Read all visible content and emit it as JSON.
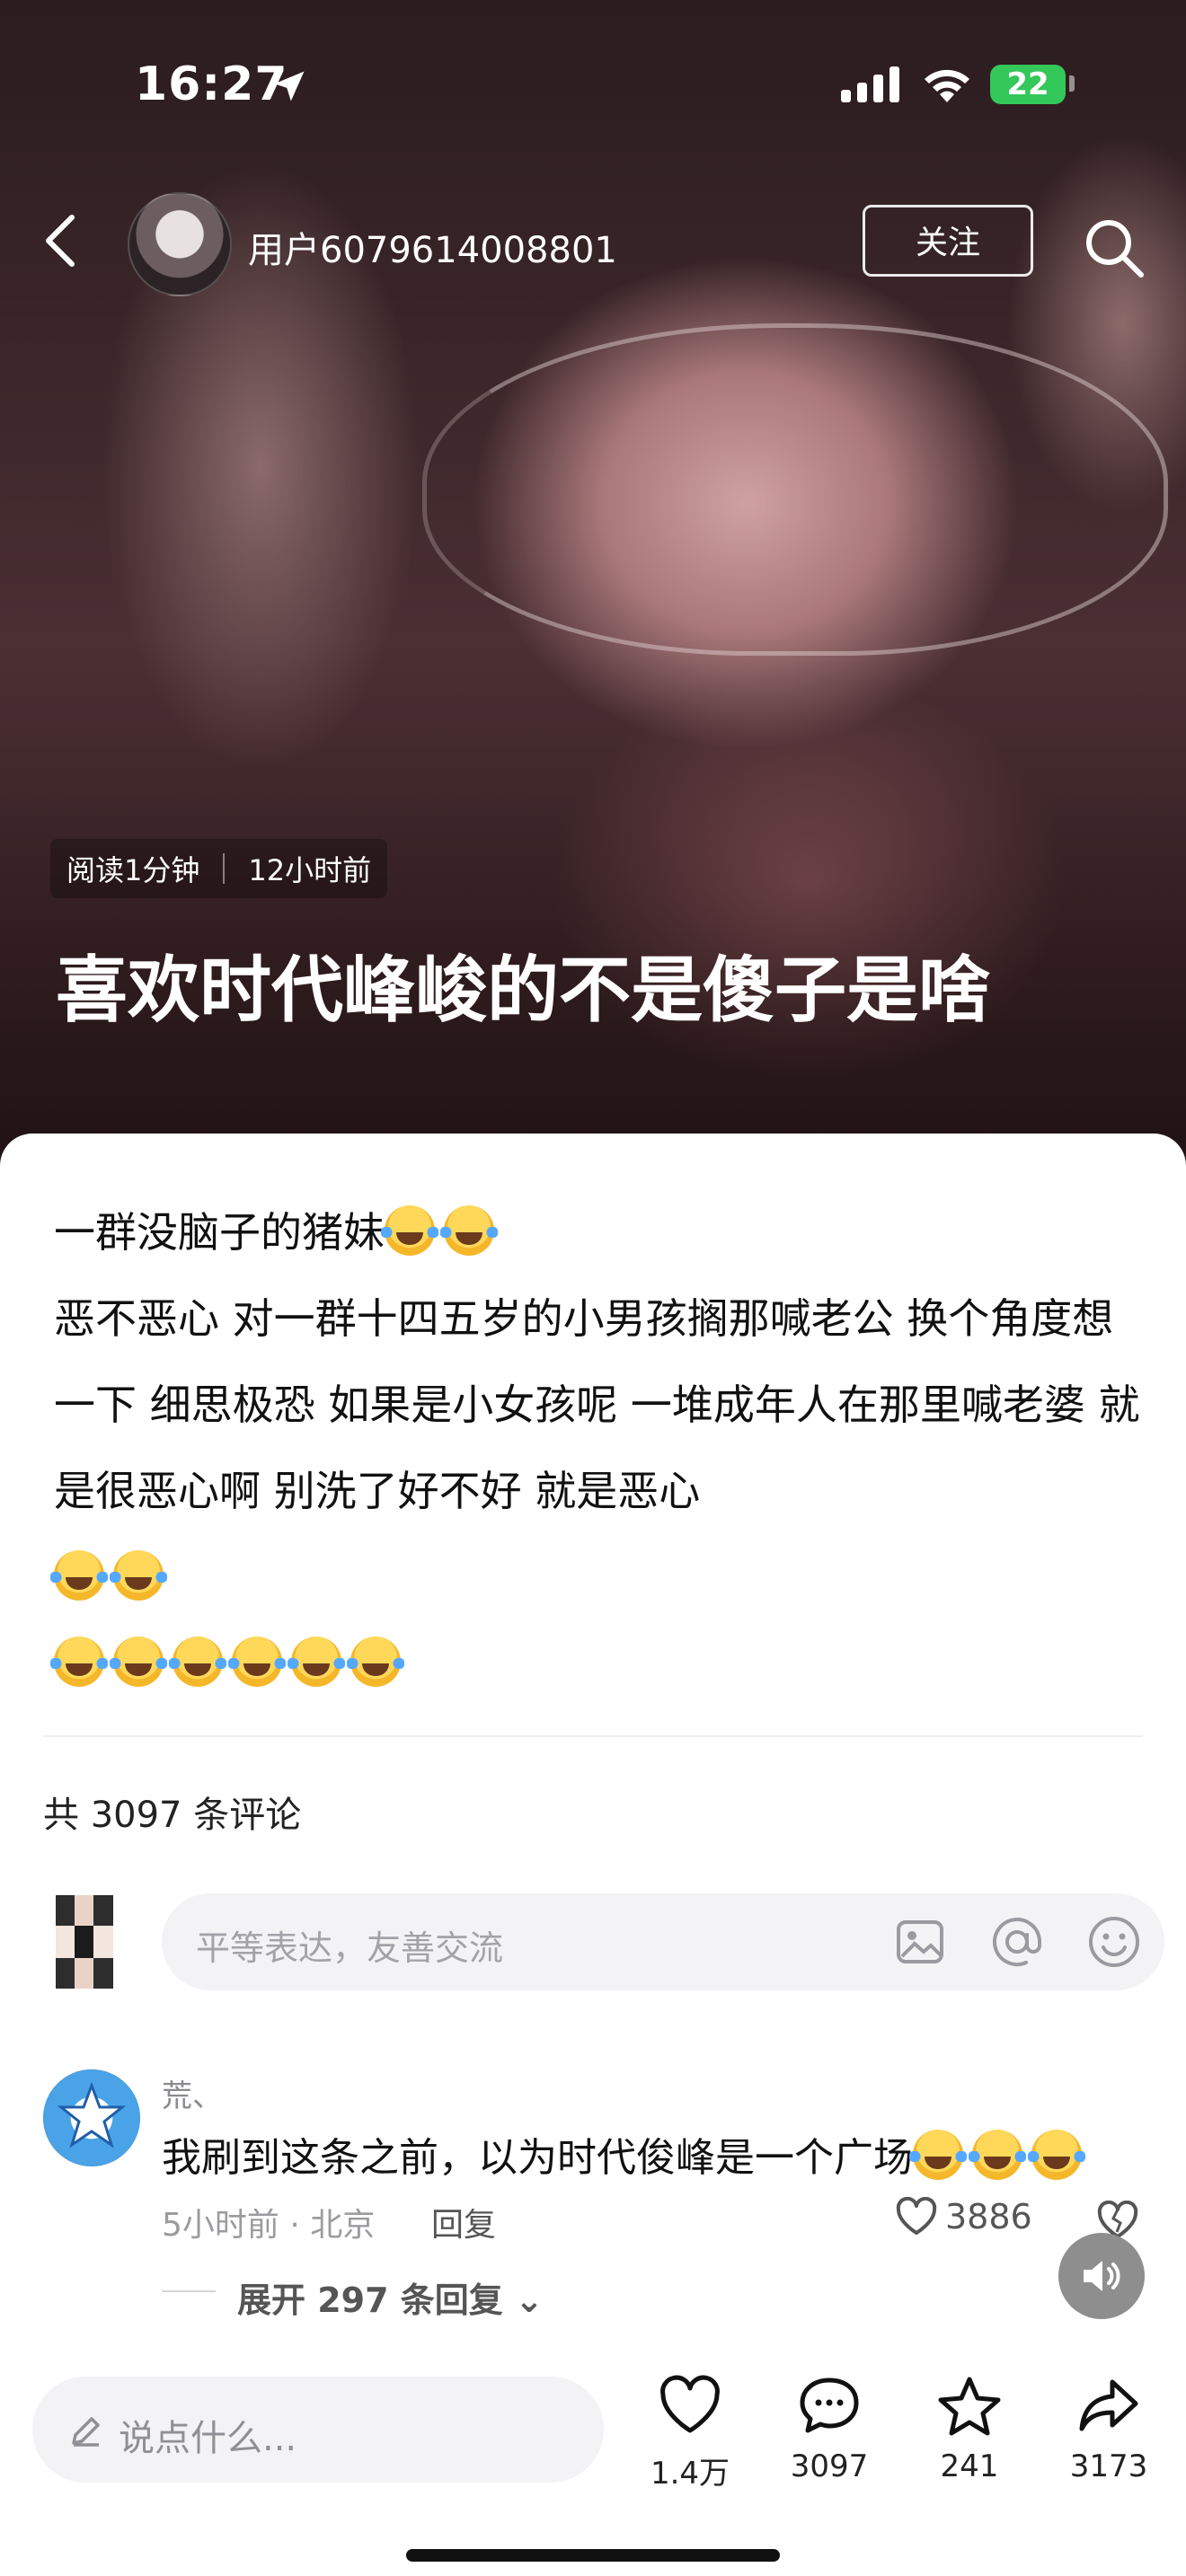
{
  "status_bar": {
    "time": "16:27",
    "battery": "22"
  },
  "header": {
    "username": "用户6079614008801",
    "follow_label": "关注"
  },
  "article": {
    "read_time": "阅读1分钟",
    "posted": "12小时前",
    "title": "喜欢时代峰峻的不是傻子是啥",
    "paragraphs": [
      "一群没脑子的猪妹",
      "恶不恶心 对一群十四五岁的小男孩搁那喊老公 换个角度想一下 细思极恐 如果是小女孩呢 一堆成年人在那里喊老婆 就是很恶心啊 别洗了好不好 就是恶心"
    ]
  },
  "comments_section": {
    "count_label": "共 3097 条评论",
    "input_placeholder": "平等表达，友善交流",
    "items": [
      {
        "author": "荒、",
        "text": "我刷到这条之前，以为时代俊峰是一个广场",
        "meta": "5小时前 · 北京",
        "reply_label": "回复",
        "likes": "3886",
        "expand_label": "展开 297 条回复"
      }
    ]
  },
  "bottom_bar": {
    "placeholder": "说点什么...",
    "like_count": "1.4万",
    "comment_count": "3097",
    "favorite_count": "241",
    "share_count": "3173"
  }
}
